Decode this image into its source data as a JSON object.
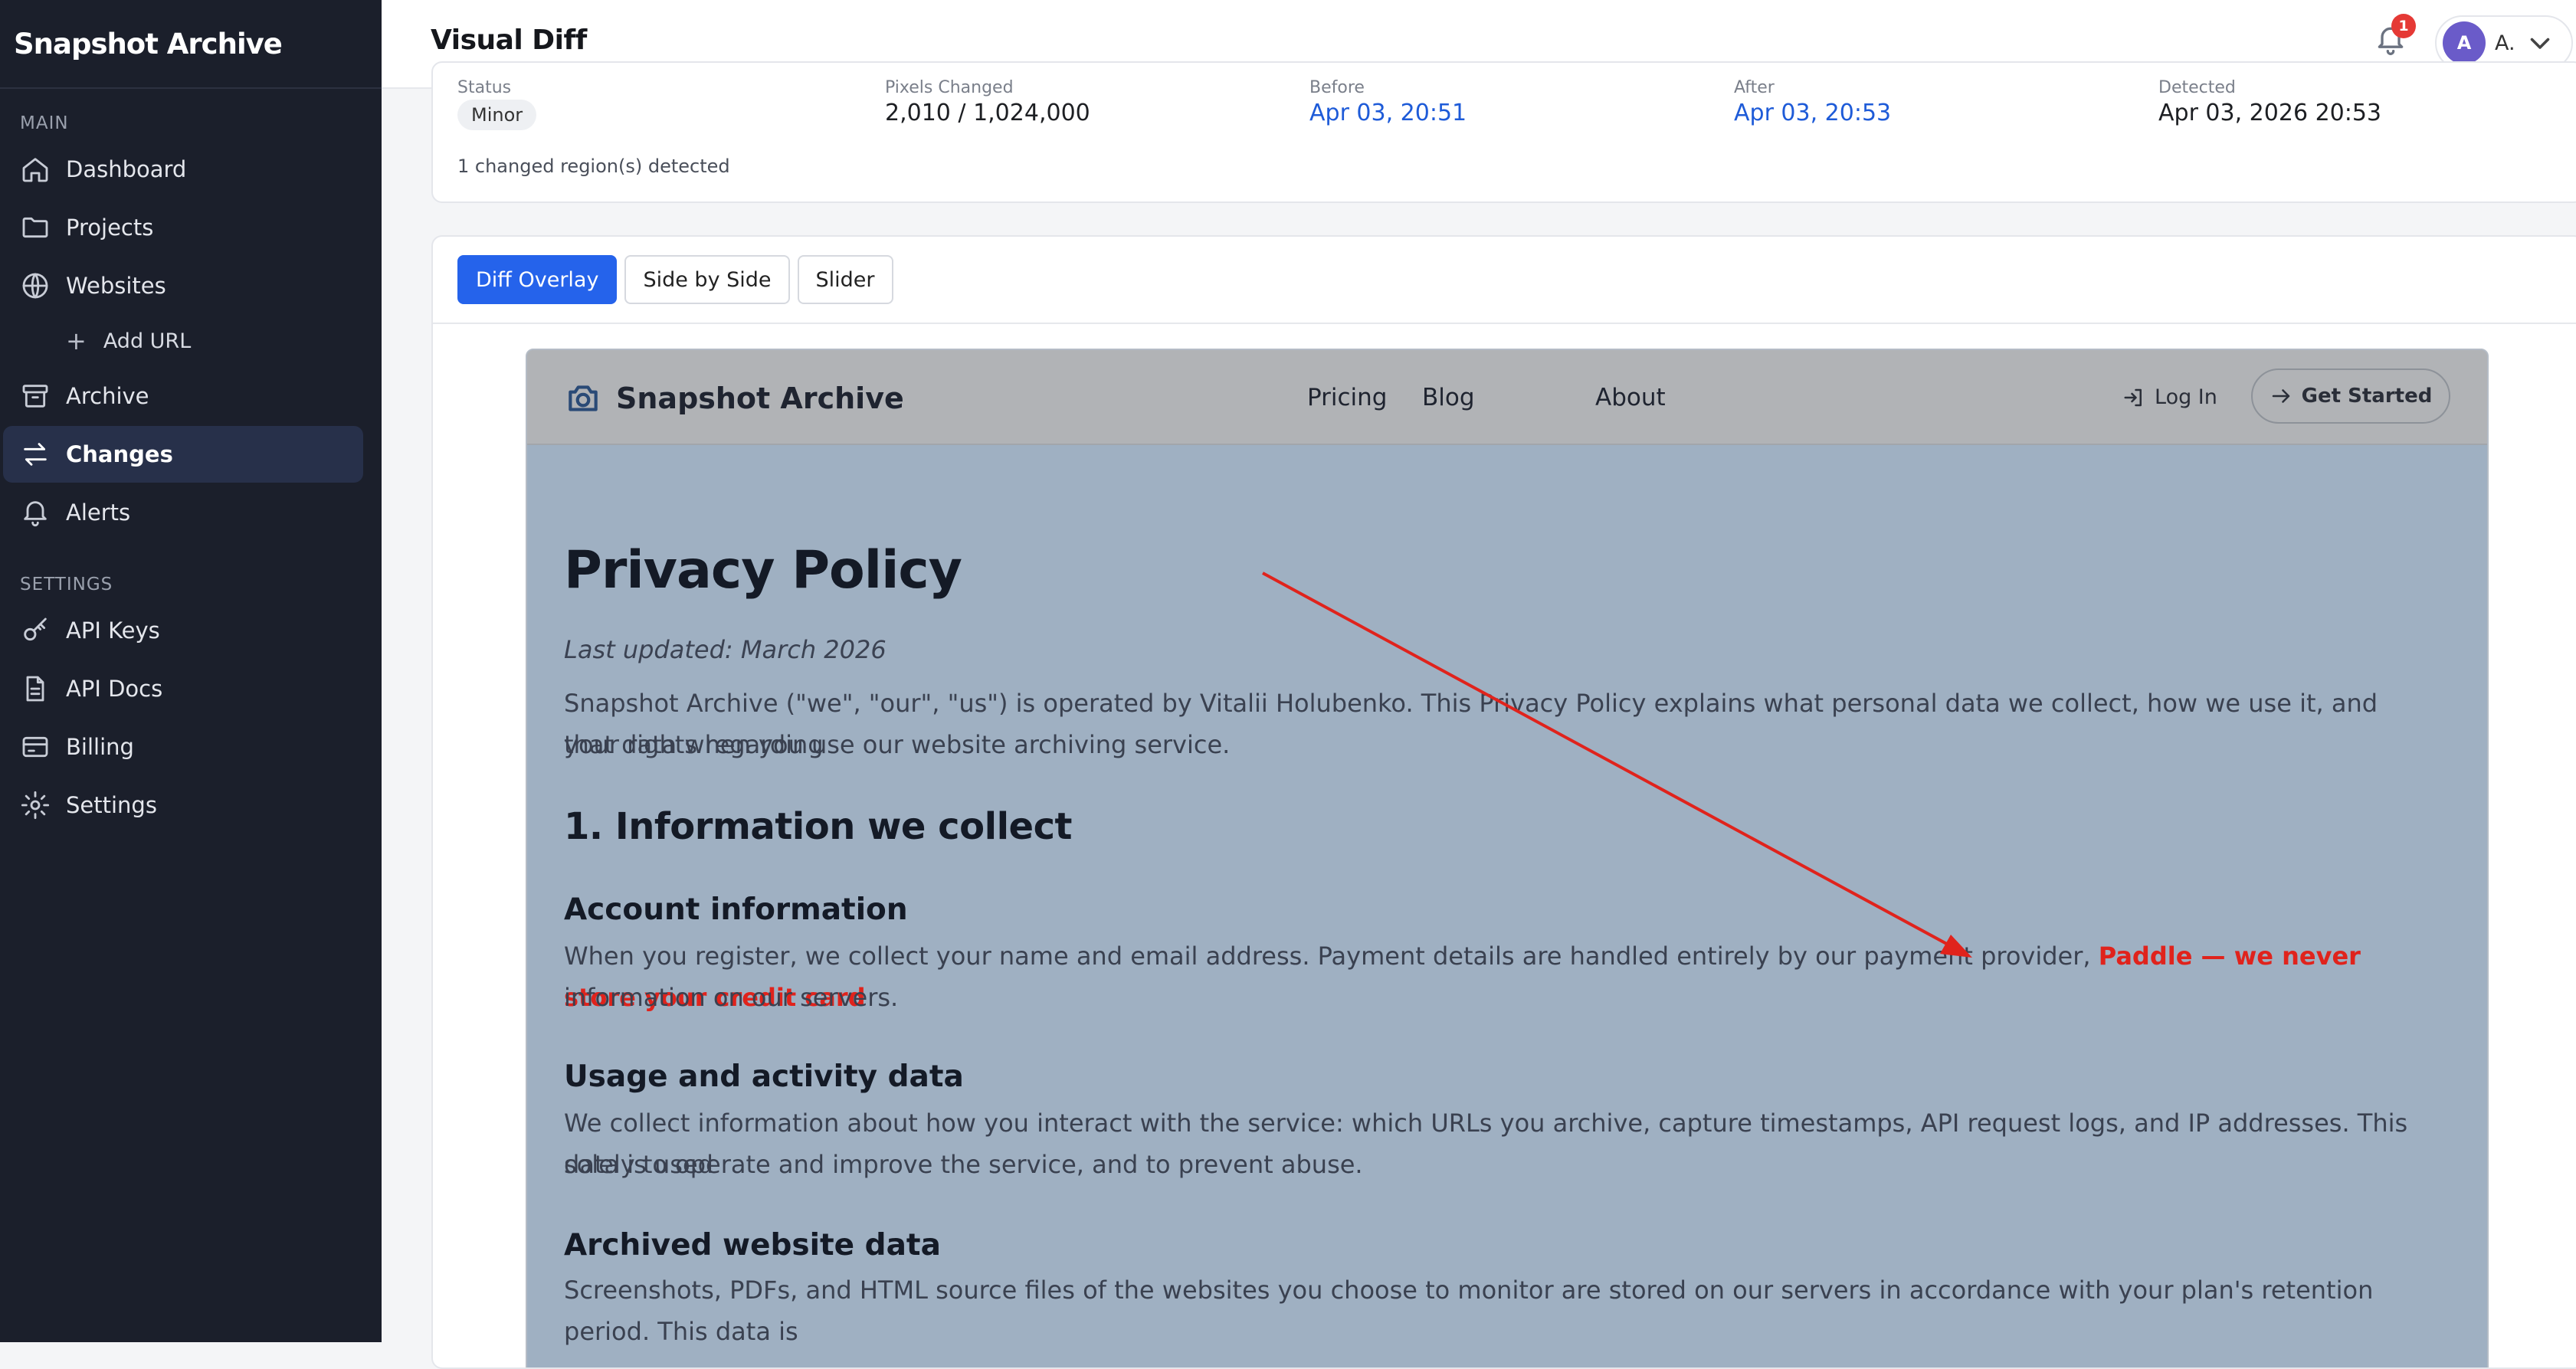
{
  "sidebar": {
    "brand": "Snapshot Archive",
    "main_title": "MAIN",
    "settings_title": "SETTINGS",
    "items": {
      "dashboard": "Dashboard",
      "projects": "Projects",
      "websites": "Websites",
      "add_url": "Add URL",
      "archive": "Archive",
      "changes": "Changes",
      "alerts": "Alerts",
      "api_keys": "API Keys",
      "api_docs": "API Docs",
      "billing": "Billing",
      "settings": "Settings"
    },
    "active_item": "Changes"
  },
  "header": {
    "title": "Visual Diff",
    "notification_count": "1",
    "user_initial": "A",
    "user_name": "A."
  },
  "summary": {
    "status_label": "Status",
    "status_value": "Minor",
    "pixels_label": "Pixels Changed",
    "pixels_value": "2,010 / 1,024,000",
    "before_label": "Before",
    "before_value": "Apr 03, 20:51",
    "after_label": "After",
    "after_value": "Apr 03, 20:53",
    "detected_label": "Detected",
    "detected_value": "Apr 03, 2026 20:53",
    "regions_text": "1 changed region(s) detected"
  },
  "viewer": {
    "tabs": [
      "Diff Overlay",
      "Side by Side",
      "Slider"
    ],
    "active_tab": "Diff Overlay"
  },
  "preview": {
    "logo": "Snapshot Archive",
    "nav": [
      "Pricing",
      "Blog",
      "About"
    ],
    "login": "Log In",
    "cta": "Get Started",
    "heading": "Privacy Policy",
    "updated": "Last updated: March 2026",
    "intro_line1": "Snapshot Archive (\"we\", \"our\", \"us\") is operated by Vitalii Holubenko. This Privacy Policy explains what personal data we collect, how we use it, and your rights regarding",
    "intro_line2": "that data when you use our website archiving service.",
    "section1": "1. Information we collect",
    "account_heading": "Account information",
    "account_line1_prefix": "When you register, we collect your name and email address. Payment details are handled entirely by our payment provider,",
    "account_changed": "Paddle — we never store your credit card",
    "account_line2": "information on our servers.",
    "usage_heading": "Usage and activity data",
    "usage_line1": "We collect information about how you interact with the service: which URLs you archive, capture timestamps, API request logs, and IP addresses. This data is used",
    "usage_line2": "solely to operate and improve the service, and to prevent abuse.",
    "archived_heading": "Archived website data",
    "archived_line1": "Screenshots, PDFs, and HTML source files of the websites you choose to monitor are stored on our servers in accordance with your plan's retention period. This data is"
  },
  "colors": {
    "sidebar_bg": "#1b1f2b",
    "accent": "#2563eb",
    "diff_highlight": "#e0231c",
    "link": "#1e5bd8"
  }
}
